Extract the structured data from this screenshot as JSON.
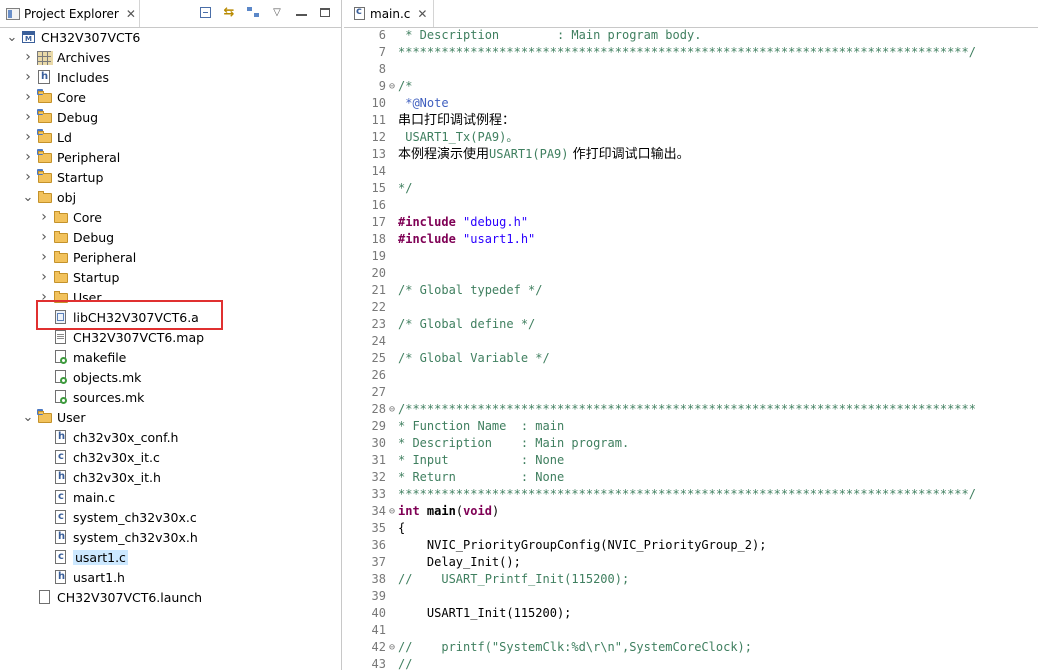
{
  "explorer": {
    "title": "Project Explorer",
    "close": "✕",
    "toolbar": {
      "menu": "▽"
    },
    "items": [
      {
        "label": "CH32V307VCT6",
        "depth": 0,
        "arrow": "open",
        "icon": "project"
      },
      {
        "label": "Archives",
        "depth": 1,
        "arrow": "closed",
        "icon": "archives"
      },
      {
        "label": "Includes",
        "depth": 1,
        "arrow": "closed",
        "icon": "includes"
      },
      {
        "label": "Core",
        "depth": 1,
        "arrow": "closed",
        "icon": "srcfolder"
      },
      {
        "label": "Debug",
        "depth": 1,
        "arrow": "closed",
        "icon": "srcfolder"
      },
      {
        "label": "Ld",
        "depth": 1,
        "arrow": "closed",
        "icon": "srcfolder"
      },
      {
        "label": "Peripheral",
        "depth": 1,
        "arrow": "closed",
        "icon": "srcfolder"
      },
      {
        "label": "Startup",
        "depth": 1,
        "arrow": "closed",
        "icon": "srcfolder"
      },
      {
        "label": "obj",
        "depth": 1,
        "arrow": "open",
        "icon": "folder"
      },
      {
        "label": "Core",
        "depth": 2,
        "arrow": "closed",
        "icon": "folder"
      },
      {
        "label": "Debug",
        "depth": 2,
        "arrow": "closed",
        "icon": "folder"
      },
      {
        "label": "Peripheral",
        "depth": 2,
        "arrow": "closed",
        "icon": "folder"
      },
      {
        "label": "Startup",
        "depth": 2,
        "arrow": "closed",
        "icon": "folder"
      },
      {
        "label": "User",
        "depth": 2,
        "arrow": "closed",
        "icon": "folder"
      },
      {
        "label": "libCH32V307VCT6.a",
        "depth": 2,
        "arrow": "none",
        "icon": "lib"
      },
      {
        "label": "CH32V307VCT6.map",
        "depth": 2,
        "arrow": "none",
        "icon": "textfile"
      },
      {
        "label": "makefile",
        "depth": 2,
        "arrow": "none",
        "icon": "make"
      },
      {
        "label": "objects.mk",
        "depth": 2,
        "arrow": "none",
        "icon": "make"
      },
      {
        "label": "sources.mk",
        "depth": 2,
        "arrow": "none",
        "icon": "make"
      },
      {
        "label": "User",
        "depth": 1,
        "arrow": "open",
        "icon": "srcfolder"
      },
      {
        "label": "ch32v30x_conf.h",
        "depth": 2,
        "arrow": "none",
        "icon": "h"
      },
      {
        "label": "ch32v30x_it.c",
        "depth": 2,
        "arrow": "none",
        "icon": "c"
      },
      {
        "label": "ch32v30x_it.h",
        "depth": 2,
        "arrow": "none",
        "icon": "h"
      },
      {
        "label": "main.c",
        "depth": 2,
        "arrow": "none",
        "icon": "c"
      },
      {
        "label": "system_ch32v30x.c",
        "depth": 2,
        "arrow": "none",
        "icon": "c"
      },
      {
        "label": "system_ch32v30x.h",
        "depth": 2,
        "arrow": "none",
        "icon": "h"
      },
      {
        "label": "usart1.c",
        "depth": 2,
        "arrow": "none",
        "icon": "c",
        "selected": true
      },
      {
        "label": "usart1.h",
        "depth": 2,
        "arrow": "none",
        "icon": "h"
      },
      {
        "label": "CH32V307VCT6.launch",
        "depth": 1,
        "arrow": "none",
        "icon": "launch"
      }
    ]
  },
  "editor": {
    "tab_label": "main.c",
    "close": "✕",
    "lines": [
      {
        "n": "6",
        "fold": "",
        "segs": [
          [
            "cmt",
            " * Description        : Main program body."
          ]
        ]
      },
      {
        "n": "7",
        "fold": "",
        "segs": [
          [
            "cmt",
            "*******************************************************************************/"
          ]
        ]
      },
      {
        "n": "8",
        "fold": "",
        "segs": []
      },
      {
        "n": "9",
        "fold": "⊖",
        "segs": [
          [
            "cmt",
            "/*"
          ]
        ]
      },
      {
        "n": "10",
        "fold": "",
        "segs": [
          [
            "cmtdoc",
            " *@Note"
          ]
        ]
      },
      {
        "n": "11",
        "fold": "",
        "segs": [
          [
            "cn",
            "串口打印调试例程："
          ]
        ]
      },
      {
        "n": "12",
        "fold": "",
        "segs": [
          [
            "cmt",
            " USART1_Tx(PA9)。"
          ]
        ]
      },
      {
        "n": "13",
        "fold": "",
        "segs": [
          [
            "cn",
            "本例程演示使用"
          ],
          [
            "cmt",
            "USART1(PA9)"
          ],
          [
            "cn",
            " 作打印调试口输出。"
          ]
        ]
      },
      {
        "n": "14",
        "fold": "",
        "segs": []
      },
      {
        "n": "15",
        "fold": "",
        "segs": [
          [
            "cmt",
            "*/"
          ]
        ]
      },
      {
        "n": "16",
        "fold": "",
        "segs": []
      },
      {
        "n": "17",
        "fold": "",
        "segs": [
          [
            "kw",
            "#include"
          ],
          [
            "plain",
            " "
          ],
          [
            "str",
            "\"debug.h\""
          ]
        ]
      },
      {
        "n": "18",
        "fold": "",
        "segs": [
          [
            "kw",
            "#include"
          ],
          [
            "plain",
            " "
          ],
          [
            "str",
            "\"usart1.h\""
          ]
        ]
      },
      {
        "n": "19",
        "fold": "",
        "segs": []
      },
      {
        "n": "20",
        "fold": "",
        "segs": []
      },
      {
        "n": "21",
        "fold": "",
        "segs": [
          [
            "cmt",
            "/* Global typedef */"
          ]
        ]
      },
      {
        "n": "22",
        "fold": "",
        "segs": []
      },
      {
        "n": "23",
        "fold": "",
        "segs": [
          [
            "cmt",
            "/* Global define */"
          ]
        ]
      },
      {
        "n": "24",
        "fold": "",
        "segs": []
      },
      {
        "n": "25",
        "fold": "",
        "segs": [
          [
            "cmt",
            "/* Global Variable */"
          ]
        ]
      },
      {
        "n": "26",
        "fold": "",
        "segs": []
      },
      {
        "n": "27",
        "fold": "",
        "segs": []
      },
      {
        "n": "28",
        "fold": "⊖",
        "segs": [
          [
            "cmt",
            "/*******************************************************************************"
          ]
        ]
      },
      {
        "n": "29",
        "fold": "",
        "segs": [
          [
            "cmt",
            "* Function Name  : main"
          ]
        ]
      },
      {
        "n": "30",
        "fold": "",
        "segs": [
          [
            "cmt",
            "* Description    : Main program."
          ]
        ]
      },
      {
        "n": "31",
        "fold": "",
        "segs": [
          [
            "cmt",
            "* Input          : None"
          ]
        ]
      },
      {
        "n": "32",
        "fold": "",
        "segs": [
          [
            "cmt",
            "* Return         : None"
          ]
        ]
      },
      {
        "n": "33",
        "fold": "",
        "segs": [
          [
            "cmt",
            "*******************************************************************************/"
          ]
        ]
      },
      {
        "n": "34",
        "fold": "⊖",
        "segs": [
          [
            "kw",
            "int"
          ],
          [
            "plain",
            " "
          ],
          [
            "bold",
            "main"
          ],
          [
            "plain",
            "("
          ],
          [
            "kw",
            "void"
          ],
          [
            "plain",
            ")"
          ]
        ]
      },
      {
        "n": "35",
        "fold": "",
        "segs": [
          [
            "plain",
            "{"
          ]
        ]
      },
      {
        "n": "36",
        "fold": "",
        "segs": [
          [
            "plain",
            "    NVIC_PriorityGroupConfig(NVIC_PriorityGroup_2);"
          ]
        ]
      },
      {
        "n": "37",
        "fold": "",
        "segs": [
          [
            "plain",
            "    Delay_Init();"
          ]
        ]
      },
      {
        "n": "38",
        "fold": "",
        "segs": [
          [
            "cmt",
            "//    USART_Printf_Init(115200);"
          ]
        ]
      },
      {
        "n": "39",
        "fold": "",
        "segs": []
      },
      {
        "n": "40",
        "fold": "",
        "segs": [
          [
            "plain",
            "    USART1_Init(115200);"
          ]
        ]
      },
      {
        "n": "41",
        "fold": "",
        "segs": []
      },
      {
        "n": "42",
        "fold": "⊖",
        "segs": [
          [
            "cmt",
            "//    printf(\"SystemClk:%d\\r\\n\",SystemCoreClock);"
          ]
        ]
      },
      {
        "n": "43",
        "fold": "",
        "segs": [
          [
            "cmt",
            "//"
          ]
        ]
      }
    ]
  }
}
